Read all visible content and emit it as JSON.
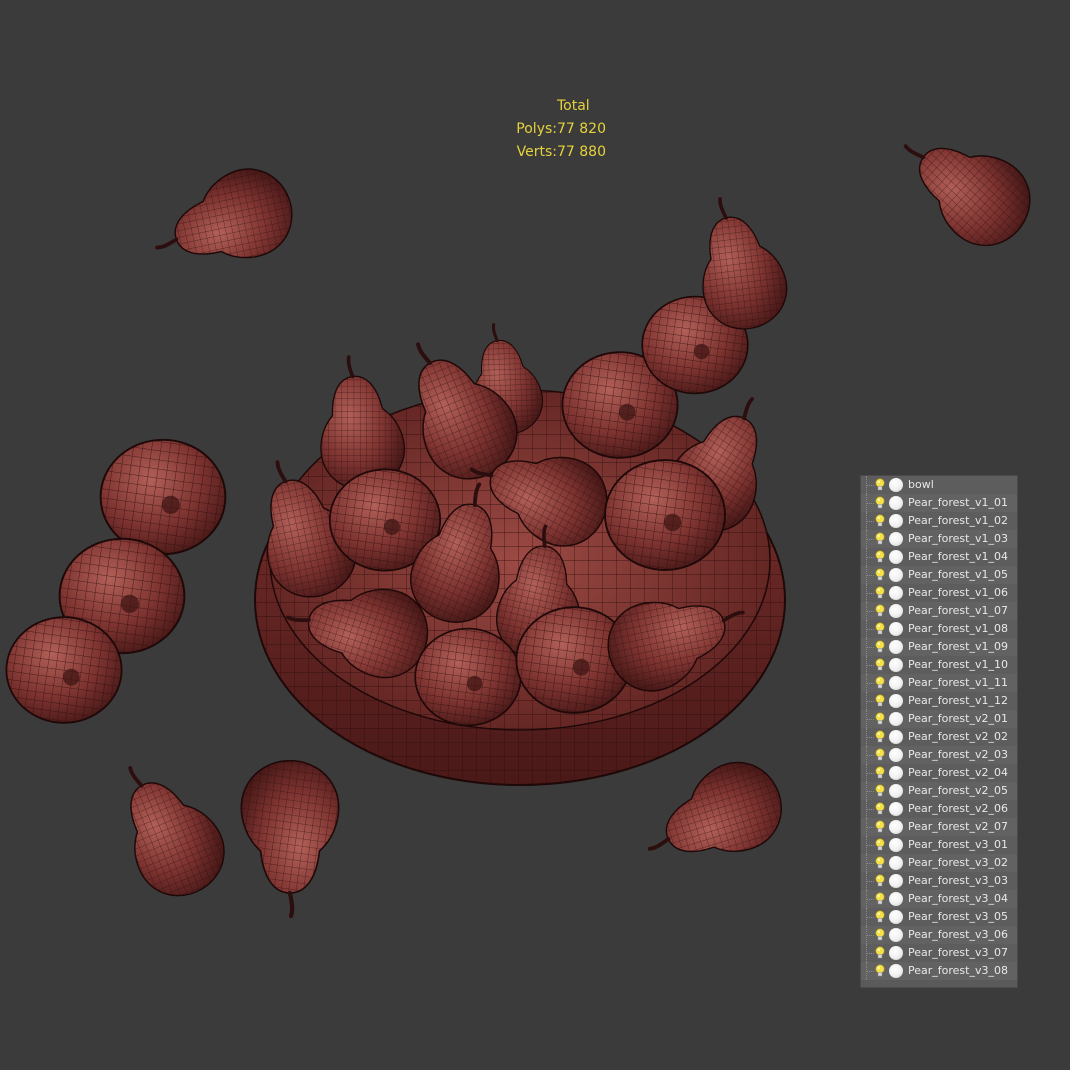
{
  "stats": {
    "header": "Total",
    "polys_label": "Polys:",
    "polys_value": "77 820",
    "verts_label": "Verts:",
    "verts_value": "77 880",
    "color": "#e6d23c"
  },
  "scene": {
    "items": [
      "bowl",
      "Pear_forest_v1_01",
      "Pear_forest_v1_02",
      "Pear_forest_v1_03",
      "Pear_forest_v1_04",
      "Pear_forest_v1_05",
      "Pear_forest_v1_06",
      "Pear_forest_v1_07",
      "Pear_forest_v1_08",
      "Pear_forest_v1_09",
      "Pear_forest_v1_10",
      "Pear_forest_v1_11",
      "Pear_forest_v1_12",
      "Pear_forest_v2_01",
      "Pear_forest_v2_02",
      "Pear_forest_v2_03",
      "Pear_forest_v2_04",
      "Pear_forest_v2_05",
      "Pear_forest_v2_06",
      "Pear_forest_v2_07",
      "Pear_forest_v3_01",
      "Pear_forest_v3_02",
      "Pear_forest_v3_03",
      "Pear_forest_v3_04",
      "Pear_forest_v3_05",
      "Pear_forest_v3_06",
      "Pear_forest_v3_07",
      "Pear_forest_v3_08"
    ],
    "icons": [
      "lightbulb-icon",
      "render-sphere-icon"
    ]
  },
  "colors": {
    "background": "#3b3b3b",
    "mesh_fill": "#7a2f2d",
    "wire": "#2a0d0d",
    "panel": "#5a5a5a"
  }
}
